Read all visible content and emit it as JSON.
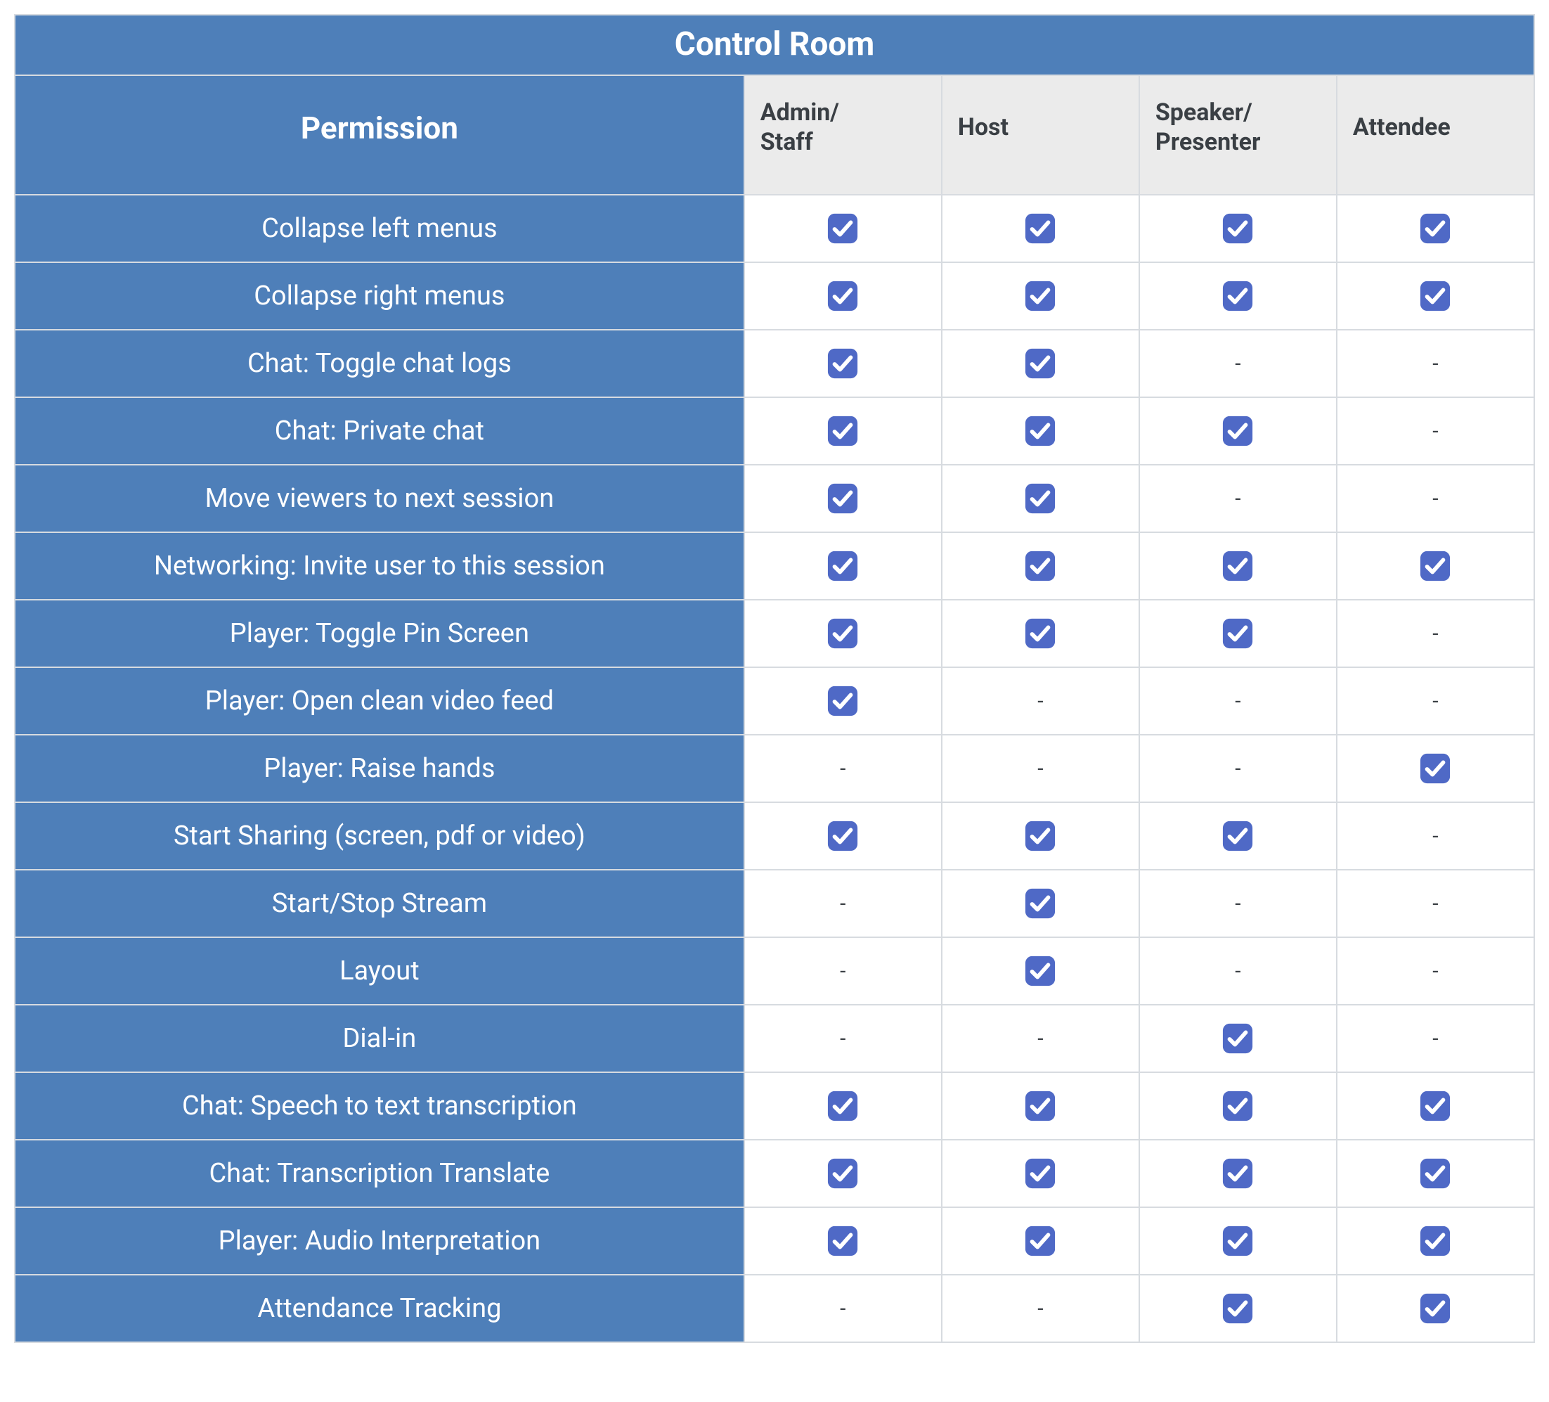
{
  "title": "Control Room",
  "headers": {
    "permission": "Permission",
    "roles": [
      "Admin/\nStaff",
      "Host",
      "Speaker/\nPresenter",
      "Attendee"
    ]
  },
  "dash": "-",
  "colors": {
    "brand_blue": "#4e7fb9",
    "check_blue": "#4f69c6"
  },
  "rows": [
    {
      "label": "Collapse left menus",
      "values": [
        true,
        true,
        true,
        true
      ]
    },
    {
      "label": "Collapse right menus",
      "values": [
        true,
        true,
        true,
        true
      ]
    },
    {
      "label": "Chat: Toggle chat logs",
      "values": [
        true,
        true,
        false,
        false
      ]
    },
    {
      "label": "Chat: Private chat",
      "values": [
        true,
        true,
        true,
        false
      ]
    },
    {
      "label": "Move viewers to next session",
      "values": [
        true,
        true,
        false,
        false
      ]
    },
    {
      "label": "Networking: Invite user to this session",
      "values": [
        true,
        true,
        true,
        true
      ]
    },
    {
      "label": "Player: Toggle Pin Screen",
      "values": [
        true,
        true,
        true,
        false
      ]
    },
    {
      "label": "Player: Open clean video feed",
      "values": [
        true,
        false,
        false,
        false
      ]
    },
    {
      "label": "Player: Raise hands",
      "values": [
        false,
        false,
        false,
        true
      ]
    },
    {
      "label": "Start Sharing (screen, pdf or video)",
      "values": [
        true,
        true,
        true,
        false
      ]
    },
    {
      "label": "Start/Stop Stream",
      "values": [
        false,
        true,
        false,
        false
      ]
    },
    {
      "label": "Layout",
      "values": [
        false,
        true,
        false,
        false
      ]
    },
    {
      "label": "Dial-in",
      "values": [
        false,
        false,
        true,
        false
      ]
    },
    {
      "label": "Chat: Speech to text transcription",
      "values": [
        true,
        true,
        true,
        true
      ]
    },
    {
      "label": "Chat: Transcription Translate",
      "values": [
        true,
        true,
        true,
        true
      ]
    },
    {
      "label": "Player: Audio Interpretation",
      "values": [
        true,
        true,
        true,
        true
      ]
    },
    {
      "label": "Attendance Tracking",
      "values": [
        false,
        false,
        true,
        true
      ]
    }
  ]
}
